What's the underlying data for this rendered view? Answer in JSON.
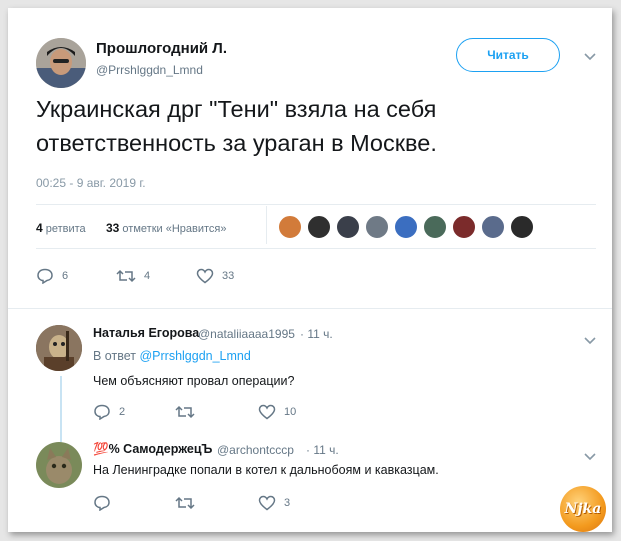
{
  "tweet": {
    "author_name": "Прошлогодний Л.",
    "author_handle": "@Prrshlggdn_Lmnd",
    "follow_label": "Читать",
    "text_line1": "Украинская дрг \"Тени\" взяла на себя",
    "text_line2": "ответственность за ураган в Москве.",
    "timestamp": "00:25 - 9 авг. 2019 г.",
    "retweets_count": "4",
    "retweets_label": "ретвита",
    "likes_count": "33",
    "likes_label": "отметки «Нравится»",
    "replies_action": "6",
    "retweets_action": "4",
    "likes_action": "33"
  },
  "likers": [
    "#d27b3a",
    "#2f2f2f",
    "#3a3f4a",
    "#6f7a86",
    "#3b6ec0",
    "#4a6a5a",
    "#7b2b2b",
    "#5a6b8c",
    "#2a2a2a"
  ],
  "replies": [
    {
      "name": "Наталья Егорова",
      "handle": "@nataliiaaaa1995",
      "time": "· 11 ч.",
      "reply_to_label": "В ответ",
      "reply_to_handle": "@Prrshlggdn_Lmnd",
      "text": "Чем объясняют провал операции?",
      "replies": "2",
      "retweets": "",
      "likes": "10"
    },
    {
      "name_emoji": "💯",
      "name": "% СамодержецЪ",
      "handle": "@archontcccp",
      "time": "· 11 ч.",
      "text": "На Ленинградке попали в котел к дальнобоям и кавказцам.",
      "replies": "",
      "retweets": "",
      "likes": "3"
    }
  ],
  "watermark": "Njka",
  "colors": {
    "accent": "#1da1f2",
    "muted": "#657786",
    "text": "#14171a"
  }
}
